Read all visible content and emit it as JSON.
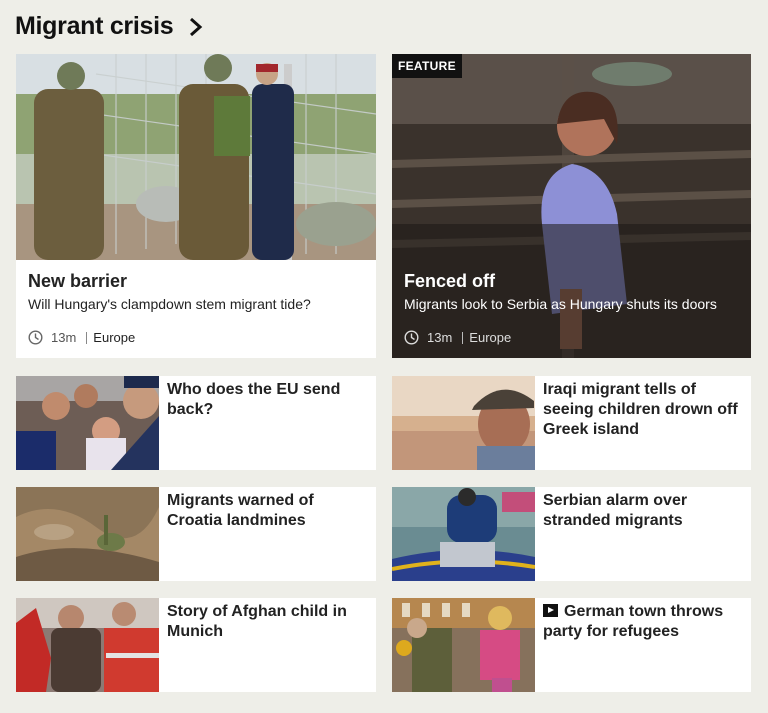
{
  "section": {
    "title": "Migrant crisis"
  },
  "lead_left": {
    "title": "New barrier",
    "summary": "Will Hungary's clampdown stem migrant tide?",
    "time": "13m",
    "section": "Europe"
  },
  "lead_right": {
    "badge": "FEATURE",
    "title": "Fenced off",
    "summary": "Migrants look to Serbia as Hungary shuts its doors",
    "time": "13m",
    "section": "Europe"
  },
  "stories": [
    {
      "title": "Who does the EU send back?"
    },
    {
      "title": "Iraqi migrant tells of seeing children drown off Greek island"
    },
    {
      "title": "Migrants warned of Croatia landmines"
    },
    {
      "title": "Serbian alarm over stranded migrants"
    },
    {
      "title": "Story of Afghan child in Munich"
    },
    {
      "title": "German town throws party for refugees",
      "video": true
    }
  ]
}
